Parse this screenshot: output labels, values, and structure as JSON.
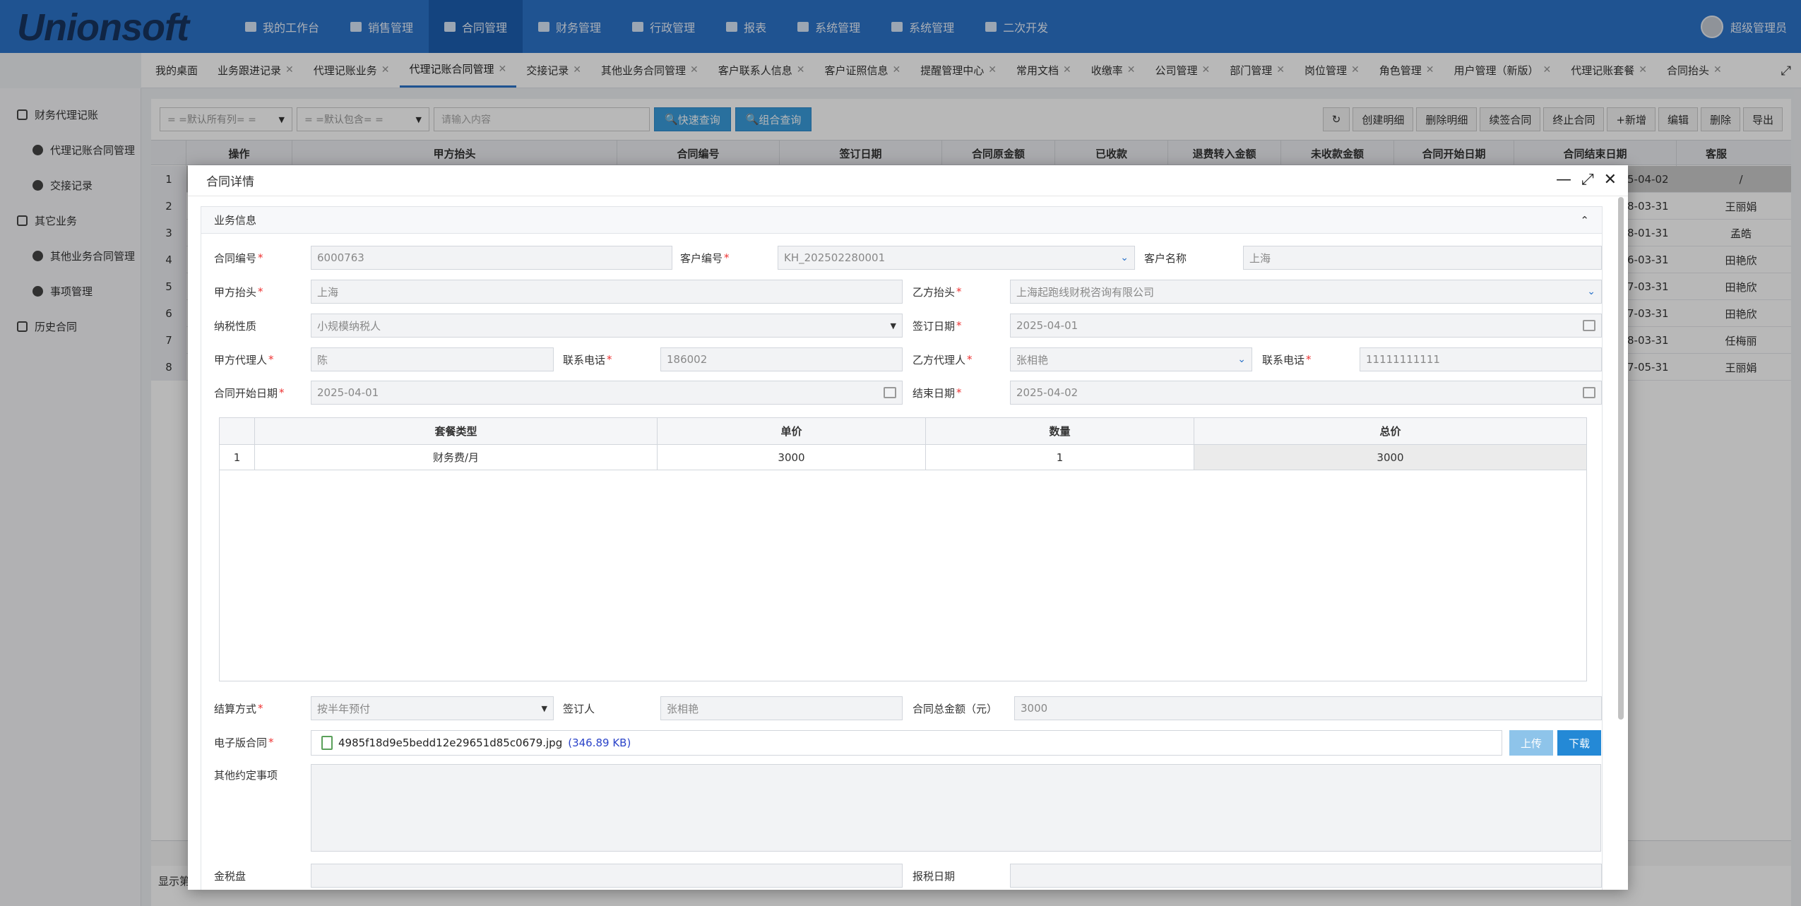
{
  "app": {
    "logo": "Unionsoft",
    "user": "超级管理员"
  },
  "topnav": [
    "我的工作台",
    "销售管理",
    "合同管理",
    "财务管理",
    "行政管理",
    "报表",
    "系统管理",
    "系统管理",
    "二次开发"
  ],
  "tabs": [
    "我的桌面",
    "业务跟进记录",
    "代理记账业务",
    "代理记账合同管理",
    "交接记录",
    "其他业务合同管理",
    "客户联系人信息",
    "客户证照信息",
    "提醒管理中心",
    "常用文档",
    "收缴率",
    "公司管理",
    "部门管理",
    "岗位管理",
    "角色管理",
    "用户管理（新版）",
    "代理记账套餐",
    "合同抬头"
  ],
  "sidebar": [
    {
      "label": "财务代理记账",
      "sub": false
    },
    {
      "label": "代理记账合同管理",
      "sub": true
    },
    {
      "label": "交接记录",
      "sub": true
    },
    {
      "label": "其它业务",
      "sub": false
    },
    {
      "label": "其他业务合同管理",
      "sub": true
    },
    {
      "label": "事项管理",
      "sub": true
    },
    {
      "label": "历史合同",
      "sub": false
    }
  ],
  "toolbar": {
    "filter1": "= =默认所有列= =",
    "filter2": "= =默认包含= =",
    "search_placeholder": "请输入内容",
    "quick": "快速查询",
    "combo": "组合查询"
  },
  "actions": [
    "创建明细",
    "删除明细",
    "续签合同",
    "终止合同",
    "+新增",
    "编辑",
    "删除",
    "导出"
  ],
  "grid": {
    "headers": [
      "操作",
      "甲方抬头",
      "合同编号",
      "签订日期",
      "合同原金额",
      "已收款",
      "退费转入金额",
      "未收款金额",
      "合同开始日期",
      "合同结束日期",
      "客服"
    ],
    "rows": [
      {
        "n": "1",
        "end": "5-04-02",
        "cs": "/"
      },
      {
        "n": "2",
        "end": "8-03-31",
        "cs": "王丽娟"
      },
      {
        "n": "3",
        "end": "8-01-31",
        "cs": "孟皓"
      },
      {
        "n": "4",
        "end": "6-03-31",
        "cs": "田艳欣"
      },
      {
        "n": "5",
        "end": "7-03-31",
        "cs": "田艳欣"
      },
      {
        "n": "6",
        "end": "7-03-31",
        "cs": "田艳欣"
      },
      {
        "n": "7",
        "end": "8-03-31",
        "cs": "任梅丽"
      },
      {
        "n": "8",
        "end": "7-05-31",
        "cs": "王丽娟"
      }
    ],
    "pager": "显示第"
  },
  "modal": {
    "title": "合同详情",
    "section": "业务信息",
    "labels": {
      "contract_no": "合同编号",
      "customer_no": "客户编号",
      "customer_name": "客户名称",
      "party_a": "甲方抬头",
      "party_b": "乙方抬头",
      "tax_type": "纳税性质",
      "sign_date": "签订日期",
      "a_agent": "甲方代理人",
      "a_phone": "联系电话",
      "b_agent": "乙方代理人",
      "b_phone": "联系电话",
      "start_date": "合同开始日期",
      "end_date": "结束日期",
      "settle": "结算方式",
      "signer": "签订人",
      "total": "合同总金额（元）",
      "econtract": "电子版合同",
      "other": "其他约定事项",
      "tax_disk": "金税盘",
      "tax_date": "报税日期"
    },
    "values": {
      "contract_no": "6000763",
      "customer_no": "KH_202502280001",
      "customer_name": "上海",
      "party_a": "上海",
      "party_b": "上海起跑线财税咨询有限公司",
      "tax_type": "小规模纳税人",
      "sign_date": "2025-04-01",
      "a_agent": "陈",
      "a_phone": "186002",
      "b_agent": "张相艳",
      "b_phone": "11111111111",
      "start_date": "2025-04-01",
      "end_date": "2025-04-02",
      "settle": "按半年预付",
      "signer": "张相艳",
      "total": "3000"
    },
    "table": {
      "headers": [
        "套餐类型",
        "单价",
        "数量",
        "总价"
      ],
      "rows": [
        {
          "n": "1",
          "type": "财务费/月",
          "price": "3000",
          "qty": "1",
          "total": "3000"
        }
      ]
    },
    "file": {
      "name": "4985f18d9e5bedd12e29651d85c0679.jpg",
      "size": "(346.89 KB)"
    },
    "upload": "上传",
    "download": "下载"
  }
}
